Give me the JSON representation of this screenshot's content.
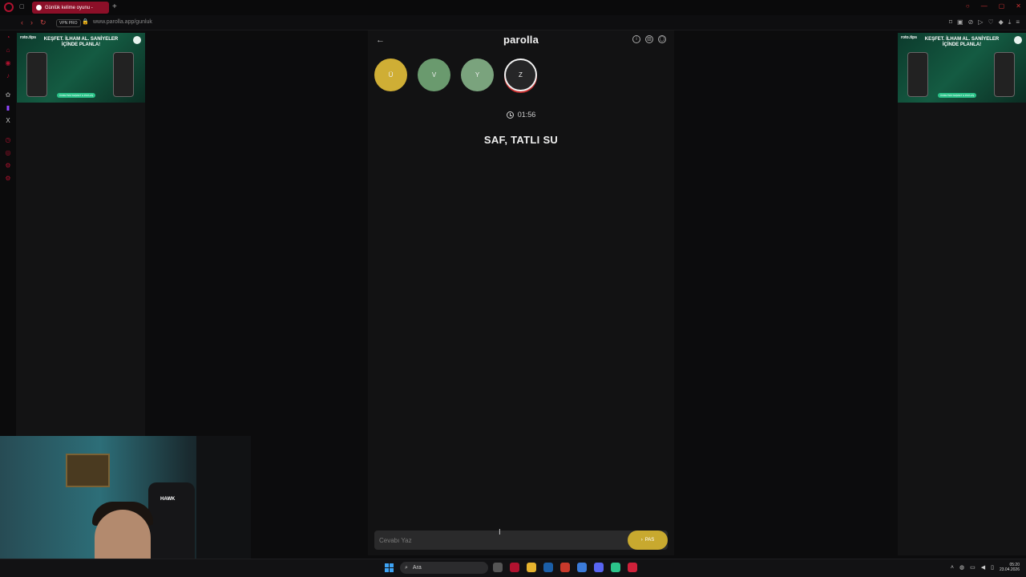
{
  "browser": {
    "tab_title": "Günlük kelime oyunu -",
    "new_tab_icon": "plus-icon",
    "vpn_label": "VPN PRO",
    "url": "www.parolla.app/gunluk"
  },
  "ads": {
    "brand": "roto.tips",
    "headline": "KEŞFET. İLHAM AL. SANİYELER İÇİNDE PLANLA!",
    "cta": "ÜCRETSİZ KEŞFET & PAYLAŞ"
  },
  "app": {
    "logo": "parolla",
    "letters": [
      {
        "letter": "Ü",
        "state": "correct-yellow"
      },
      {
        "letter": "V",
        "state": "correct-green"
      },
      {
        "letter": "Y",
        "state": "correct-green"
      },
      {
        "letter": "Z",
        "state": "active"
      }
    ],
    "timer": "01:56",
    "question": "SAF, TATLI SU",
    "answer_placeholder": "Cevabı Yaz",
    "pass_label": "PAS"
  },
  "webcam": {
    "chair_text": "HAWK"
  },
  "taskbar": {
    "search_placeholder": "Ara",
    "time": "05:20",
    "date": "23.04.2026"
  },
  "colors": {
    "yellow": "#cfae35",
    "green": "#6a9a6e",
    "accent": "#b0122f"
  }
}
